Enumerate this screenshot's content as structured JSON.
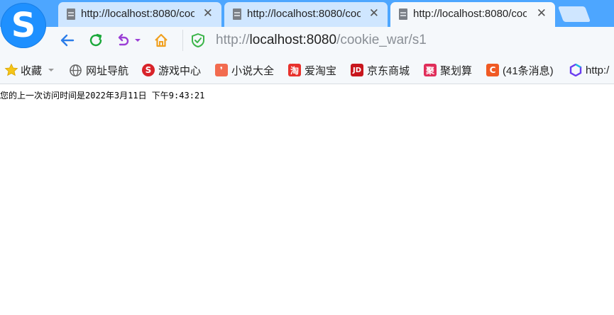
{
  "browser": {
    "tabs": [
      {
        "title": "http://localhost:8080/cookie_war/s1",
        "close": "✕",
        "active": false
      },
      {
        "title": "http://localhost:8080/cookie_war/s1",
        "close": "✕",
        "active": false
      },
      {
        "title": "http://localhost:8080/cookie_war/s1",
        "close": "✕",
        "active": true
      }
    ],
    "logo_letter": "S"
  },
  "toolbar": {
    "url_scheme": "http://",
    "url_host": "localhost:8080",
    "url_path": "/cookie_war/s1",
    "colors": {
      "back": "#2b7de9",
      "refresh": "#1aa83a",
      "undo": "#9b3fd6",
      "home": "#f0a020",
      "shield": "#3cb54a"
    }
  },
  "bookmarks": [
    {
      "label": "收藏",
      "icon": "star-icon"
    },
    {
      "label": "网址导航",
      "icon": "globe-icon"
    },
    {
      "label": "游戏中心",
      "icon": "game-icon"
    },
    {
      "label": "小说大全",
      "icon": "book-icon"
    },
    {
      "label": "爱淘宝",
      "icon": "taobao-icon",
      "glyph": "淘"
    },
    {
      "label": "京东商城",
      "icon": "jd-icon",
      "glyph": "JD"
    },
    {
      "label": "聚划算",
      "icon": "juhuasuan-icon",
      "glyph": "聚"
    },
    {
      "label": "(41条消息)",
      "icon": "csdn-icon",
      "glyph": "C"
    },
    {
      "label": "http:/",
      "icon": "site-icon"
    }
  ],
  "page": {
    "visit_text": "您的上一次访问时间是2022年3月11日 下午9:43:21"
  }
}
